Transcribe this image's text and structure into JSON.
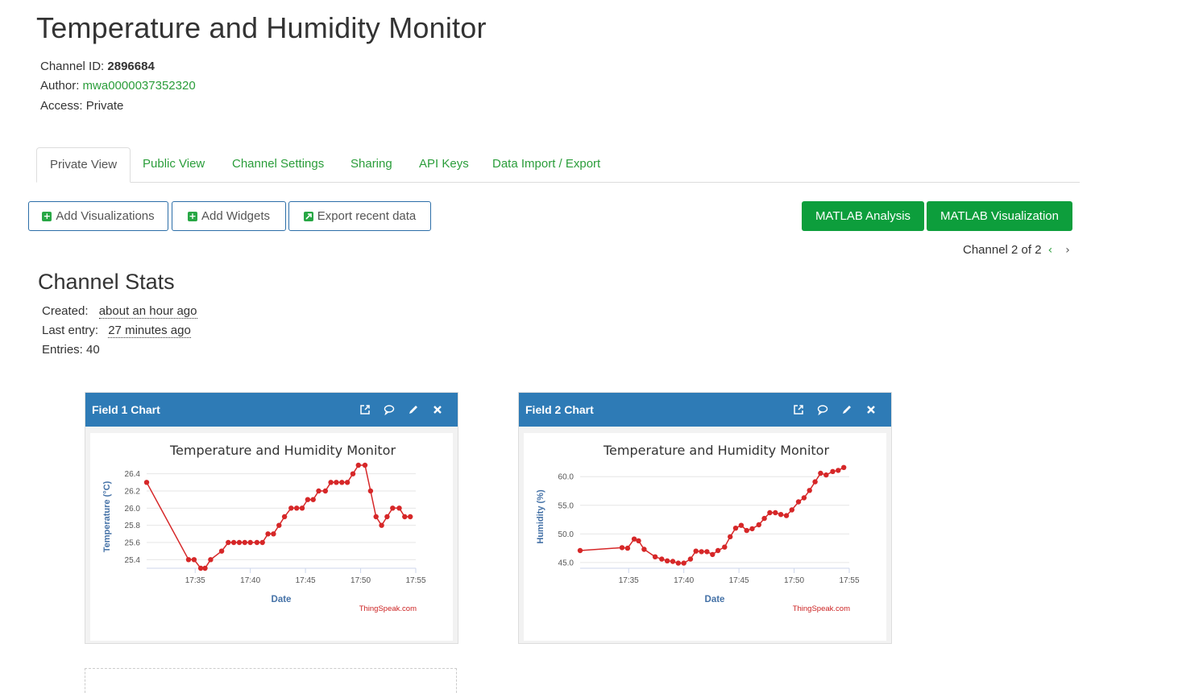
{
  "page": {
    "title": "Temperature and Humidity Monitor",
    "channel_id_label": "Channel ID:",
    "channel_id": "2896684",
    "author_label": "Author:",
    "author": "mwa0000037352320",
    "access_label": "Access:",
    "access": "Private"
  },
  "tabs": [
    "Private View",
    "Public View",
    "Channel Settings",
    "Sharing",
    "API Keys",
    "Data Import / Export"
  ],
  "toolbar": {
    "add_visualizations": "Add Visualizations",
    "add_widgets": "Add Widgets",
    "export_recent": "Export recent data",
    "matlab_analysis": "MATLAB Analysis",
    "matlab_visualization": "MATLAB Visualization",
    "channel_nav": "Channel 2 of 2"
  },
  "stats": {
    "title": "Channel Stats",
    "created_label": "Created:",
    "created": "about an hour ago",
    "last_entry_label": "Last entry:",
    "last_entry": "27 minutes ago",
    "entries": "Entries: 40"
  },
  "colors": {
    "header_blue": "#2e7bb6",
    "green": "#0d9e3c",
    "series_red": "#d62728"
  },
  "panels": [
    {
      "title": "Field 1 Chart"
    },
    {
      "title": "Field 2 Chart"
    }
  ],
  "chart_data": [
    {
      "type": "line",
      "title": "Temperature and Humidity Monitor",
      "xlabel": "Date",
      "ylabel": "Temperature (°C)",
      "credit": "ThingSpeak.com",
      "x_ticks": [
        "17:35",
        "17:40",
        "17:45",
        "17:50",
        "17:55"
      ],
      "y_ticks": [
        "25.4",
        "25.6",
        "25.8",
        "26.0",
        "26.2",
        "26.4"
      ],
      "ylim": [
        25.3,
        26.5
      ],
      "xlim": [
        30.6,
        55.0
      ],
      "series": [
        {
          "x": [
            30.6,
            34.4,
            34.9,
            35.5,
            35.9,
            36.4,
            37.4,
            38.0,
            38.5,
            39.0,
            39.5,
            40.0,
            40.6,
            41.1,
            41.6,
            42.1,
            42.6,
            43.1,
            43.7,
            44.2,
            44.7,
            45.2,
            45.7,
            46.2,
            46.8,
            47.3,
            47.8,
            48.3,
            48.8,
            49.3,
            49.8,
            50.4,
            50.9,
            51.4,
            51.9,
            52.4,
            52.9,
            53.5,
            54.0,
            54.5
          ],
          "y": [
            26.3,
            25.4,
            25.4,
            25.3,
            25.3,
            25.4,
            25.5,
            25.6,
            25.6,
            25.6,
            25.6,
            25.6,
            25.6,
            25.6,
            25.7,
            25.7,
            25.8,
            25.9,
            26.0,
            26.0,
            26.0,
            26.1,
            26.1,
            26.2,
            26.2,
            26.3,
            26.3,
            26.3,
            26.3,
            26.4,
            26.5,
            26.5,
            26.2,
            25.9,
            25.8,
            25.9,
            26.0,
            26.0,
            25.9,
            25.9
          ]
        }
      ]
    },
    {
      "type": "line",
      "title": "Temperature and Humidity Monitor",
      "xlabel": "Date",
      "ylabel": "Humidity (%)",
      "credit": "ThingSpeak.com",
      "x_ticks": [
        "17:35",
        "17:40",
        "17:45",
        "17:50",
        "17:55"
      ],
      "y_ticks": [
        "45.0",
        "50.0",
        "55.0",
        "60.0"
      ],
      "ylim": [
        44.0,
        62.0
      ],
      "xlim": [
        30.6,
        55.0
      ],
      "series": [
        {
          "x": [
            30.6,
            34.4,
            34.9,
            35.5,
            35.9,
            36.4,
            37.4,
            38.0,
            38.5,
            39.0,
            39.5,
            40.0,
            40.6,
            41.1,
            41.6,
            42.1,
            42.6,
            43.1,
            43.7,
            44.2,
            44.7,
            45.2,
            45.7,
            46.2,
            46.8,
            47.3,
            47.8,
            48.3,
            48.8,
            49.3,
            49.8,
            50.4,
            50.9,
            51.4,
            51.9,
            52.4,
            52.9,
            53.5,
            54.0,
            54.5
          ],
          "y": [
            47.1,
            47.6,
            47.5,
            49.1,
            48.8,
            47.3,
            46.0,
            45.6,
            45.3,
            45.2,
            44.9,
            44.9,
            45.6,
            47.0,
            46.9,
            46.9,
            46.4,
            47.1,
            47.7,
            49.5,
            51.0,
            51.5,
            50.6,
            50.9,
            51.6,
            52.7,
            53.7,
            53.7,
            53.4,
            53.2,
            54.2,
            55.6,
            56.3,
            57.6,
            59.1,
            60.6,
            60.3,
            60.9,
            61.1,
            61.6
          ]
        }
      ]
    }
  ]
}
